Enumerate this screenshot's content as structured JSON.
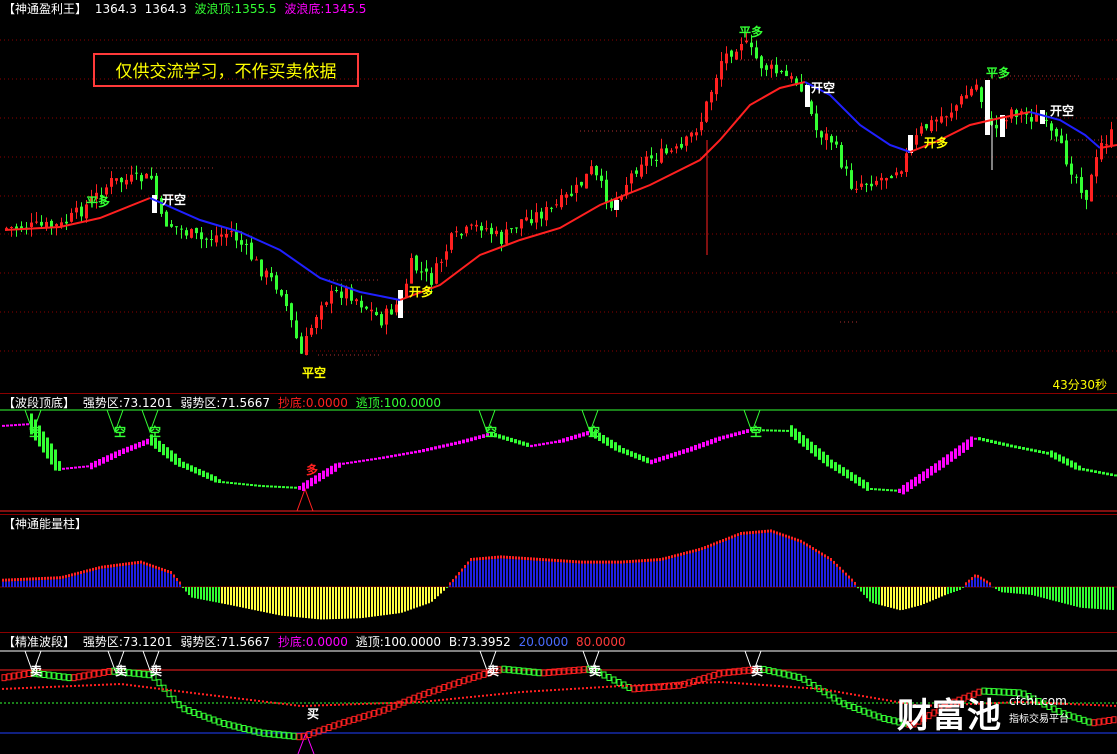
{
  "main": {
    "title": "【神通盈利王】",
    "price_a": "1364.3",
    "price_b": "1364.3",
    "wave_top": "波浪顶:1355.5",
    "wave_bottom": "波浪底:1345.5",
    "notice": "仅供交流学习，不作买卖依据",
    "timer": "43分30秒",
    "signals": [
      "平多",
      "开空",
      "平空",
      "开多",
      "平多",
      "开空",
      "开多",
      "平多",
      "开空"
    ]
  },
  "band": {
    "title": "【波段顶底】",
    "strong": "强势区:73.1201",
    "weak": "弱势区:71.5667",
    "bottom": "抄底:0.0000",
    "escape": "逃顶:100.0000",
    "signals": [
      "空",
      "空",
      "空",
      "多",
      "空",
      "空",
      "空"
    ]
  },
  "energy": {
    "title": "【神通能量柱】"
  },
  "precise": {
    "title": "【精准波段】",
    "strong": "强势区:73.1201",
    "weak": "弱势区:71.5667",
    "bottom": "抄底:0.0000",
    "escape": "逃顶:100.0000",
    "b_value": "B:73.3952",
    "v20": "20.0000",
    "v80": "80.0000",
    "signals": [
      "卖",
      "卖",
      "卖",
      "买",
      "卖",
      "卖",
      "卖"
    ]
  },
  "watermark": {
    "brand": "财富池",
    "domain": "cfchi.com",
    "sub": "指标交易平台"
  },
  "colors": {
    "up": "#ff2020",
    "down": "#33ff33",
    "ma_up": "#ff2020",
    "ma_down": "#2020ff",
    "magenta": "#ff00ff",
    "yellow": "#ffff00",
    "blue_bar": "#2020e0"
  }
}
